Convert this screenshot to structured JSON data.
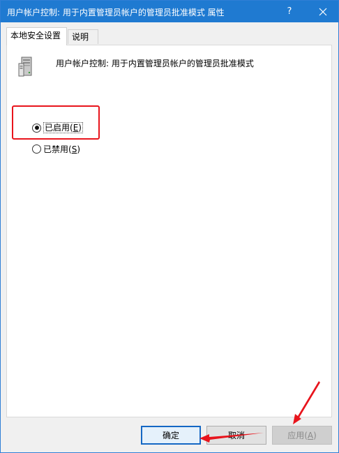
{
  "window": {
    "title": "用户帐户控制: 用于内置管理员帐户的管理员批准模式 属性",
    "help_label": "?",
    "accent": "#1f7ad1"
  },
  "tabs": [
    {
      "label": "本地安全设置",
      "active": true
    },
    {
      "label": "说明",
      "active": false
    }
  ],
  "policy": {
    "icon": "server-icon",
    "name": "用户帐户控制: 用于内置管理员帐户的管理员批准模式"
  },
  "options": {
    "enabled": {
      "label": "已启用",
      "key_open": "(",
      "key": "E",
      "key_close": ")",
      "checked": true
    },
    "disabled": {
      "label": "已禁用",
      "key_open": "(",
      "key": "S",
      "key_close": ")",
      "checked": false
    }
  },
  "buttons": {
    "ok": "确定",
    "cancel": "取消",
    "apply_label": "应用",
    "apply_key_open": "(",
    "apply_key": "A",
    "apply_key_close": ")"
  },
  "annotation_color": "#e8141c"
}
